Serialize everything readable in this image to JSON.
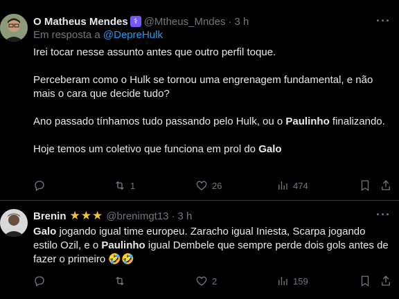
{
  "tweets": [
    {
      "display_name": "O Matheus Mendes",
      "handle": "@Mtheus_Mndes",
      "time": "3 h",
      "replying_prefix": "Em resposta a",
      "replying_to": "@DepreHulk",
      "lines": [
        "Irei tocar nesse assunto antes que outro perfil toque.",
        "Perceberam como o Hulk se tornou uma engrenagem fundamental, e não mais o cara que decide tudo?",
        [
          "Ano passado tínhamos tudo passando pelo Hulk, ou o ",
          "Paulinho",
          " finalizando."
        ],
        [
          "Hoje temos um coletivo que funciona em prol do ",
          "Galo"
        ]
      ],
      "replies": "",
      "retweets": "1",
      "likes": "26",
      "views": "474"
    },
    {
      "display_name": "Brenin",
      "badge": "★★★",
      "handle": "@brenimgt13",
      "time": "3 h",
      "text_parts": [
        "Galo",
        " jogando igual time europeu. Zaracho igual Iniesta, Scarpa jogando estilo Ozil, e o ",
        "Paulinho",
        " igual Dembele que sempre perde dois gols antes de fazer o primeiro ",
        "🤣🤣"
      ],
      "replies": "",
      "retweets": "",
      "likes": "2",
      "views": "159"
    }
  ],
  "icons": {
    "more": "more-horizontal-icon",
    "reply": "reply-icon",
    "retweet": "retweet-icon",
    "like": "heart-icon",
    "views": "views-icon",
    "bookmark": "bookmark-icon",
    "share": "share-icon",
    "verified": "purple-badge-icon"
  },
  "colors": {
    "background": "#000000",
    "text": "#e7e9ea",
    "muted": "#71767b",
    "link": "#1d9bf0",
    "divider": "#2f3336",
    "stars": "#f4c430",
    "badge": "#7856ff"
  }
}
